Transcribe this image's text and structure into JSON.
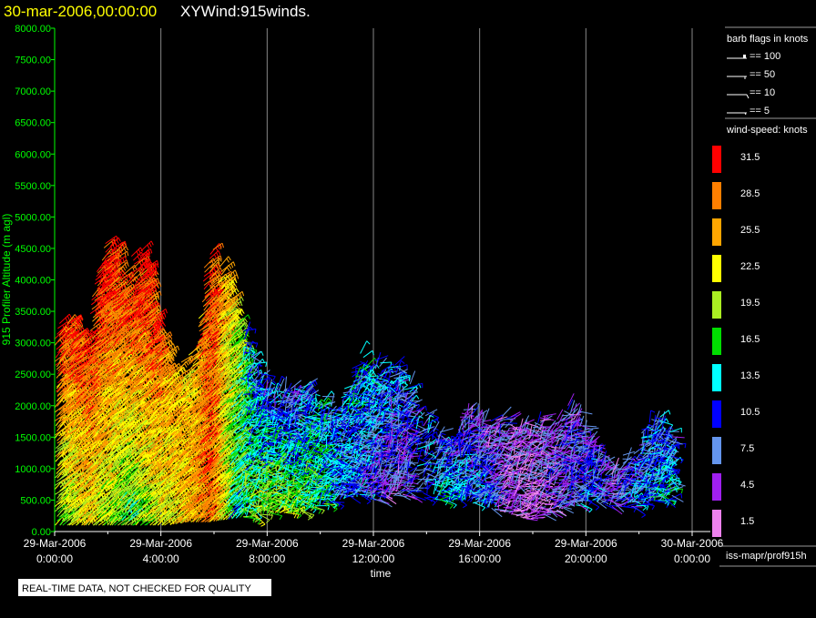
{
  "header": {
    "datetime": "30-mar-2006,00:00:00",
    "title": "XYWind:915winds."
  },
  "notice": "REAL-TIME DATA, NOT CHECKED FOR QUALITY",
  "source": "iss-mapr/prof915h",
  "colors": {
    "y_axis": "#00ff00",
    "title_date": "#ffff00",
    "grid": "#888888"
  },
  "barb_legend": {
    "title": "barb flags in knots",
    "items": [
      "== 100",
      "== 50",
      "== 10",
      "== 5"
    ]
  },
  "speed_legend": {
    "title": "wind-speed: knots",
    "levels": [
      {
        "label": "31.5",
        "color": "#ff0000"
      },
      {
        "label": "28.5",
        "color": "#ff7f00"
      },
      {
        "label": "25.5",
        "color": "#ffa500"
      },
      {
        "label": "22.5",
        "color": "#ffff00"
      },
      {
        "label": "19.5",
        "color": "#aaee22"
      },
      {
        "label": "16.5",
        "color": "#00dd00"
      },
      {
        "label": "13.5",
        "color": "#00ffff"
      },
      {
        "label": "10.5",
        "color": "#0000ff"
      },
      {
        "label": "7.5",
        "color": "#6495ed"
      },
      {
        "label": "4.5",
        "color": "#a020f0"
      },
      {
        "label": "1.5",
        "color": "#ee82ee"
      }
    ]
  },
  "chart_data": {
    "type": "scatter",
    "subtype": "wind-barb",
    "xlabel": "time",
    "ylabel": "915 Profiler Altitude (m agl)",
    "xlim_hours": [
      0,
      24
    ],
    "ylim": [
      0,
      8000
    ],
    "yticks": [
      "0.00",
      "500.00",
      "1000.00",
      "1500.00",
      "2000.00",
      "2500.00",
      "3000.00",
      "3500.00",
      "4000.00",
      "4500.00",
      "5000.00",
      "5500.00",
      "6000.00",
      "6500.00",
      "7000.00",
      "7500.00",
      "8000.00"
    ],
    "xticks": [
      {
        "date": "29-Mar-2006",
        "time": "0:00:00"
      },
      {
        "date": "29-Mar-2006",
        "time": "4:00:00"
      },
      {
        "date": "29-Mar-2006",
        "time": "8:00:00"
      },
      {
        "date": "29-Mar-2006",
        "time": "12:00:00"
      },
      {
        "date": "29-Mar-2006",
        "time": "16:00:00"
      },
      {
        "date": "29-Mar-2006",
        "time": "20:00:00"
      },
      {
        "date": "30-Mar-2006",
        "time": "0:00:00"
      }
    ],
    "grid": "vertical lines every 4 hours",
    "legend": "right",
    "profile_envelope": [
      {
        "hour": 0.2,
        "top_m": 3700,
        "base_m": 100,
        "speed_top_kt": 31,
        "speed_low_kt": 18
      },
      {
        "hour": 1.0,
        "top_m": 2900,
        "base_m": 100,
        "speed_top_kt": 30,
        "speed_low_kt": 22
      },
      {
        "hour": 1.8,
        "top_m": 4500,
        "base_m": 100,
        "speed_top_kt": 32,
        "speed_low_kt": 20
      },
      {
        "hour": 2.6,
        "top_m": 4300,
        "base_m": 100,
        "speed_top_kt": 31,
        "speed_low_kt": 16
      },
      {
        "hour": 3.4,
        "top_m": 4400,
        "base_m": 100,
        "speed_top_kt": 32,
        "speed_low_kt": 20
      },
      {
        "hour": 4.2,
        "top_m": 2800,
        "base_m": 100,
        "speed_top_kt": 26,
        "speed_low_kt": 22
      },
      {
        "hour": 5.0,
        "top_m": 2600,
        "base_m": 150,
        "speed_top_kt": 24,
        "speed_low_kt": 26
      },
      {
        "hour": 5.8,
        "top_m": 4400,
        "base_m": 150,
        "speed_top_kt": 30,
        "speed_low_kt": 28
      },
      {
        "hour": 6.6,
        "top_m": 3800,
        "base_m": 200,
        "speed_top_kt": 22,
        "speed_low_kt": 14
      },
      {
        "hour": 7.4,
        "top_m": 2800,
        "base_m": 250,
        "speed_top_kt": 10,
        "speed_low_kt": 18
      },
      {
        "hour": 8.2,
        "top_m": 2300,
        "base_m": 300,
        "speed_top_kt": 9,
        "speed_low_kt": 20
      },
      {
        "hour": 9.0,
        "top_m": 2300,
        "base_m": 300,
        "speed_top_kt": 8,
        "speed_low_kt": 18
      },
      {
        "hour": 9.8,
        "top_m": 2200,
        "base_m": 400,
        "speed_top_kt": 12,
        "speed_low_kt": 16
      },
      {
        "hour": 10.6,
        "top_m": 2000,
        "base_m": 500,
        "speed_top_kt": 10,
        "speed_low_kt": 12
      },
      {
        "hour": 11.4,
        "top_m": 2900,
        "base_m": 600,
        "speed_top_kt": 13,
        "speed_low_kt": 9
      },
      {
        "hour": 12.2,
        "top_m": 2700,
        "base_m": 500,
        "speed_top_kt": 12,
        "speed_low_kt": 6
      },
      {
        "hour": 13.0,
        "top_m": 2500,
        "base_m": 600,
        "speed_top_kt": 10,
        "speed_low_kt": 5
      },
      {
        "hour": 14.6,
        "top_m": 1500,
        "base_m": 500,
        "speed_top_kt": 8,
        "speed_low_kt": 13
      },
      {
        "hour": 15.4,
        "top_m": 1900,
        "base_m": 500,
        "speed_top_kt": 6,
        "speed_low_kt": 12
      },
      {
        "hour": 16.2,
        "top_m": 1900,
        "base_m": 400,
        "speed_top_kt": 5,
        "speed_low_kt": 10
      },
      {
        "hour": 17.0,
        "top_m": 1800,
        "base_m": 300,
        "speed_top_kt": 6,
        "speed_low_kt": 4
      },
      {
        "hour": 17.8,
        "top_m": 1700,
        "base_m": 200,
        "speed_top_kt": 5,
        "speed_low_kt": 3
      },
      {
        "hour": 18.6,
        "top_m": 1800,
        "base_m": 300,
        "speed_top_kt": 7,
        "speed_low_kt": 5
      },
      {
        "hour": 19.4,
        "top_m": 2000,
        "base_m": 400,
        "speed_top_kt": 6,
        "speed_low_kt": 8
      },
      {
        "hour": 20.2,
        "top_m": 1500,
        "base_m": 500,
        "speed_top_kt": 8,
        "speed_low_kt": 10
      },
      {
        "hour": 21.0,
        "top_m": 1000,
        "base_m": 400,
        "speed_top_kt": 5,
        "speed_low_kt": 7
      },
      {
        "hour": 21.8,
        "top_m": 1400,
        "base_m": 400,
        "speed_top_kt": 8,
        "speed_low_kt": 10
      },
      {
        "hour": 22.6,
        "top_m": 1800,
        "base_m": 500,
        "speed_top_kt": 10,
        "speed_low_kt": 12
      }
    ]
  }
}
